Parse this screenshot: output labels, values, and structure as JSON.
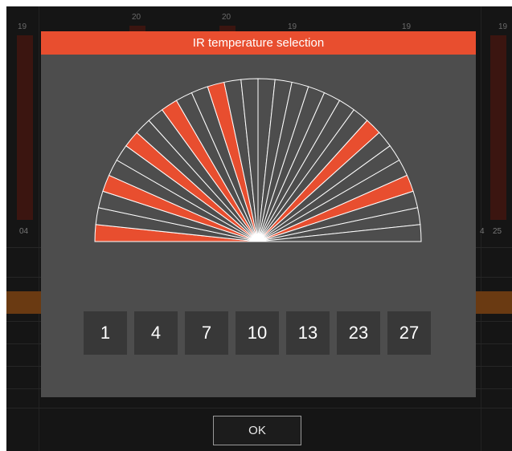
{
  "dialog": {
    "title": "IR temperature selection",
    "selected_values": [
      "1",
      "4",
      "7",
      "10",
      "13",
      "23",
      "27"
    ],
    "segment_count": 30,
    "colors": {
      "title_bar": "#e84e2f",
      "selected_segment": "#e84e2f",
      "unselected_segment": "#4d4d4d",
      "segment_line": "#ffffff",
      "panel": "#4d4d4d",
      "value_box": "#383838"
    }
  },
  "ok_button": {
    "label": "OK"
  },
  "background": {
    "top_numbers": [
      "19",
      "20",
      "20",
      "19",
      "19",
      "19"
    ],
    "side_numbers": [
      "04",
      "4",
      "25"
    ]
  }
}
